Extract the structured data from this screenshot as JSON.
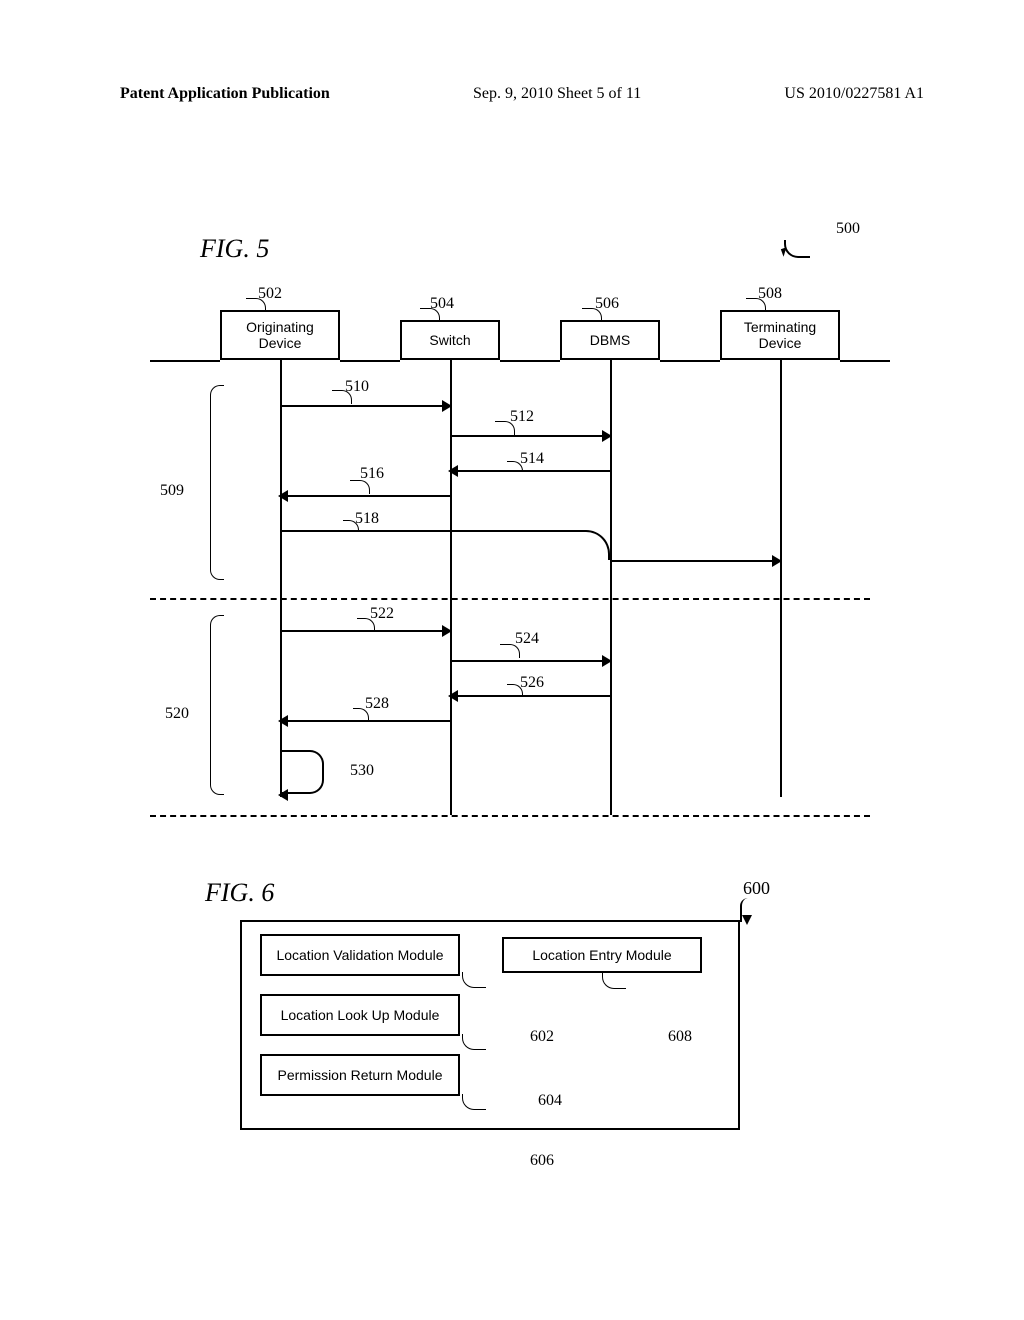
{
  "header": {
    "left": "Patent Application Publication",
    "center": "Sep. 9, 2010  Sheet 5 of 11",
    "right": "US 2010/0227581 A1"
  },
  "fig5": {
    "title": "FIG. 5",
    "ref": "500",
    "lanes": {
      "originating": {
        "label": "Originating Device",
        "ref": "502"
      },
      "switch": {
        "label": "Switch",
        "ref": "504"
      },
      "dbms": {
        "label": "DBMS",
        "ref": "506"
      },
      "terminating": {
        "label": "Terminating Device",
        "ref": "508"
      }
    },
    "groups": {
      "g509": "509",
      "g520": "520"
    },
    "messages": {
      "m510": "510",
      "m512": "512",
      "m514": "514",
      "m516": "516",
      "m518": "518",
      "m522": "522",
      "m524": "524",
      "m526": "526",
      "m528": "528",
      "m530": "530"
    }
  },
  "fig6": {
    "title": "FIG. 6",
    "ref": "600",
    "modules": {
      "location_validation": {
        "label": "Location Validation Module",
        "ref": "602"
      },
      "location_lookup": {
        "label": "Location Look Up Module",
        "ref": "604"
      },
      "permission_return": {
        "label": "Permission Return Module",
        "ref": "606"
      },
      "location_entry": {
        "label": "Location Entry Module",
        "ref": "608"
      }
    }
  }
}
